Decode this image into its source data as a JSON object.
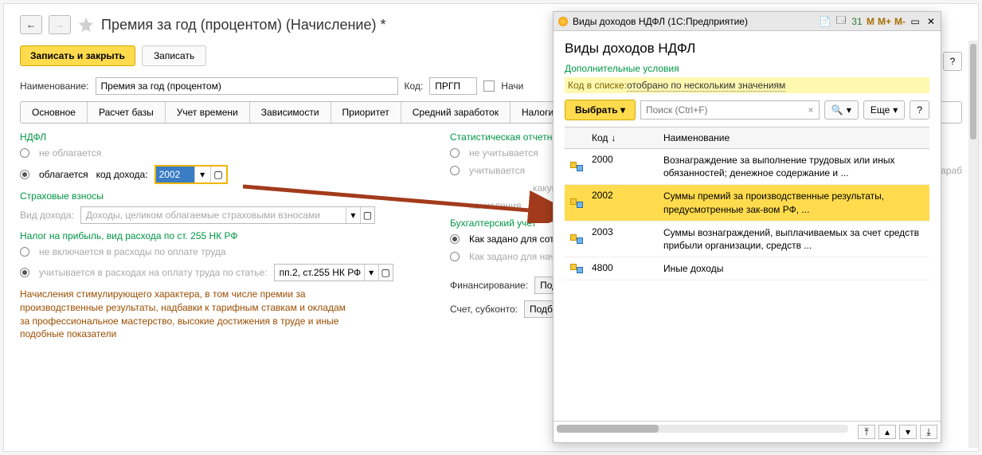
{
  "titlebar": {
    "back": "←",
    "fwd": "→",
    "title": "Премия за год (процентом) (Начисление) *"
  },
  "cmd": {
    "write_close": "Записать и закрыть",
    "write": "Записать"
  },
  "header": {
    "name_lbl": "Наименование:",
    "name_val": "Премия за год (процентом)",
    "code_lbl": "Код:",
    "code_val": "ПРГП",
    "calc_lbl": "Начи"
  },
  "tabs": [
    "Основное",
    "Расчет базы",
    "Учет времени",
    "Зависимости",
    "Приоритет",
    "Средний заработок",
    "Налоги, вз"
  ],
  "ndfl": {
    "title": "НДФЛ",
    "not_taxed": "не облагается",
    "taxed": "облагается",
    "code_lbl": "код дохода:",
    "code_val": "2002"
  },
  "contrib": {
    "title": "Страховые взносы",
    "kind_lbl": "Вид дохода:",
    "kind_val": "Доходы, целиком облагаемые страховыми взносами"
  },
  "profit": {
    "title": "Налог на прибыль, вид расхода по ст. 255 НК РФ",
    "opt1": "не включается в расходы по оплате труда",
    "opt2": "учитывается в расходах на оплату труда по статье:",
    "article": "пп.2, ст.255 НК РФ"
  },
  "note": "Начисления стимулирующего характера, в том числе премии за производственные результаты, надбавки к тарифным ставкам и окладам за профессиональное мастерство, высокие достижения в труде и иные подобные показатели",
  "stat": {
    "title": "Статистическая отчетнос",
    "o1": "не учитывается",
    "o2": "учитывается",
    "o2r": "Зараб",
    "o3": "начисления",
    "o3top": "какую из"
  },
  "bu": {
    "title": "Бухгалтерский учет",
    "o1": "Как задано для сотру",
    "o2": "Как задано для начи",
    "fin_lbl": "Финансирование:",
    "fin_ph": "Подби",
    "acc_lbl": "Счет, субконто:",
    "acc_ph": "Подби"
  },
  "popup": {
    "chrome": {
      "title": "Виды доходов НДФЛ (1С:Предприятие)",
      "M": "M",
      "Mp": "M+",
      "Mm": "M-"
    },
    "heading": "Виды доходов НДФЛ",
    "extra": "Дополнительные условия",
    "filter_k": "Код в списке:",
    "filter_v": "отобрано по нескольким значениям",
    "select": "Выбрать",
    "search_ph": "Поиск (Ctrl+F)",
    "more": "Еще",
    "col_code": "Код",
    "col_name": "Наименование",
    "rows": [
      {
        "code": "2000",
        "name": "Вознаграждение за выполнение трудовых или иных обязанностей; денежное содержание и ..."
      },
      {
        "code": "2002",
        "name": "Суммы премий за производственные результаты, предусмотренные зак-вом РФ, ..."
      },
      {
        "code": "2003",
        "name": "Суммы вознаграждений, выплачиваемых за счет средств прибыли организации, средств ..."
      },
      {
        "code": "4800",
        "name": "Иные доходы"
      }
    ]
  }
}
